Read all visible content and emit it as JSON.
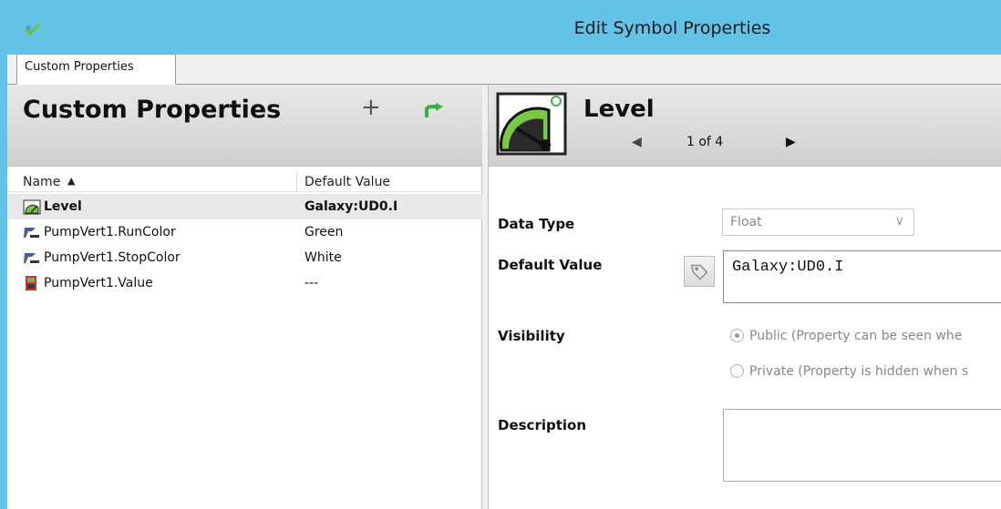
{
  "window": {
    "title": "Edit Symbol Properties"
  },
  "tabs": [
    {
      "label": "Custom Properties"
    }
  ],
  "left_panel": {
    "heading": "Custom Properties",
    "add_label": "+",
    "columns": {
      "name": "Name",
      "default_value": "Default Value"
    },
    "rows": [
      {
        "name": "Level",
        "value": "Galaxy:UD0.I",
        "icon": "gauge-icon",
        "selected": true
      },
      {
        "name": "PumpVert1.RunColor",
        "value": "Green",
        "icon": "color-property-icon"
      },
      {
        "name": "PumpVert1.StopColor",
        "value": "White",
        "icon": "color-property-icon"
      },
      {
        "name": "PumpVert1.Value",
        "value": "---",
        "icon": "pump-value-icon"
      }
    ]
  },
  "right_panel": {
    "symbol_name": "Level",
    "nav_text": "1 of 4",
    "data_type_label": "Data Type",
    "data_type_value": "Float",
    "default_value_label": "Default Value",
    "default_value": "Galaxy:UD0.I",
    "visibility_label": "Visibility",
    "public_option": "Public (Property can be seen whe",
    "private_option": "Private (Property is hidden when s",
    "description_label": "Description"
  },
  "colors": {
    "title_bar": "#62c3e6",
    "accent_green": "#3cae3c"
  }
}
